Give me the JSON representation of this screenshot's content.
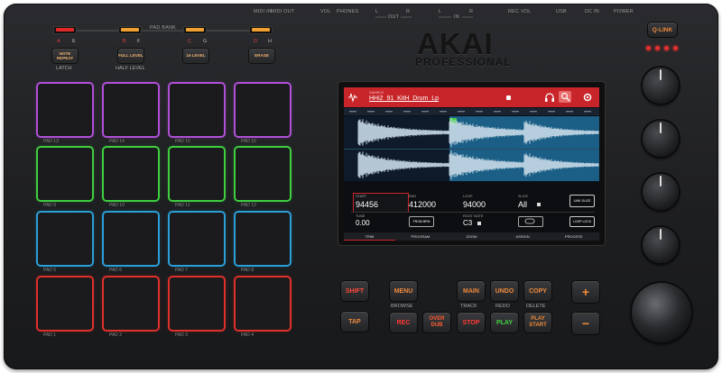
{
  "brand": {
    "name": "AKAI",
    "sub": "PROFESSIONAL"
  },
  "top_labels": {
    "pad_bank": "PAD BANK",
    "midi_in": "MIDI IN",
    "midi_out": "MIDI OUT",
    "vol": "VOL",
    "phones": "PHONES",
    "out_l": "L",
    "out": "OUT",
    "out_r": "R",
    "in_l": "L",
    "in": "IN",
    "in_r": "R",
    "rec_vol": "REC VOL",
    "usb": "USB",
    "dc_in": "DC IN",
    "power": "POWER"
  },
  "bank": {
    "a": "A",
    "e": "E",
    "b": "B",
    "f": "F",
    "c": "C",
    "g": "G",
    "d": "D",
    "h": "H"
  },
  "left_buttons": {
    "note_repeat": "NOTE REPEAT",
    "latch": "LATCH",
    "full_level": "FULL LEVEL",
    "half_level": "HALF LEVEL",
    "sixteen_level": "16 LEVEL",
    "erase": "ERASE"
  },
  "pads": [
    {
      "label": "PAD 13",
      "color": "#b14fd9"
    },
    {
      "label": "PAD 14",
      "color": "#b14fd9"
    },
    {
      "label": "PAD 15",
      "color": "#b14fd9"
    },
    {
      "label": "PAD 16",
      "color": "#b14fd9"
    },
    {
      "label": "PAD 9",
      "color": "#3fcf3f"
    },
    {
      "label": "PAD 10",
      "color": "#3fcf3f"
    },
    {
      "label": "PAD 11",
      "color": "#3fcf3f"
    },
    {
      "label": "PAD 12",
      "color": "#3fcf3f"
    },
    {
      "label": "PAD 5",
      "color": "#2a9fd8"
    },
    {
      "label": "PAD 6",
      "color": "#2a9fd8"
    },
    {
      "label": "PAD 7",
      "color": "#2a9fd8"
    },
    {
      "label": "PAD 8",
      "color": "#2a9fd8"
    },
    {
      "label": "PAD 1",
      "color": "#e0302a"
    },
    {
      "label": "PAD 2",
      "color": "#e0302a"
    },
    {
      "label": "PAD 3",
      "color": "#e0302a"
    },
    {
      "label": "PAD 4",
      "color": "#e0302a"
    }
  ],
  "qlink": "Q-LINK",
  "screen": {
    "header_small": "SAMPLE",
    "sample_name": "HHi2_91_KitH_Drum_Lp",
    "start_label": "START",
    "start_value": "94456",
    "end_label": "END",
    "end_value": "412000",
    "loop_label": "LOOP",
    "loop_value": "94000",
    "slice_label": "SLICE",
    "slice_value": "All",
    "tune_label": "TUNE",
    "tune_value": "0.00",
    "root_label": "ROOT NOTE",
    "root_value": "C3",
    "btn_link": "LINK SLICE",
    "btn_loop": "LOOP LOCK",
    "btn_from": "FROM BPM",
    "tabs": [
      "TRIM",
      "PROGRAM",
      "ZOOM",
      "ASSIGN",
      "PROCESS"
    ]
  },
  "right_buttons": {
    "shift": "SHIFT",
    "menu": "MENU",
    "browse": "BROWSE",
    "main": "MAIN",
    "track": "TRACK",
    "undo": "UNDO",
    "redo": "REDO",
    "copy": "COPY",
    "delete": "DELETE",
    "tap": "TAP",
    "rec": "REC",
    "overdub": "OVER DUB",
    "stop": "STOP",
    "play": "PLAY",
    "play_start": "PLAY START",
    "plus": "+",
    "minus": "−"
  }
}
